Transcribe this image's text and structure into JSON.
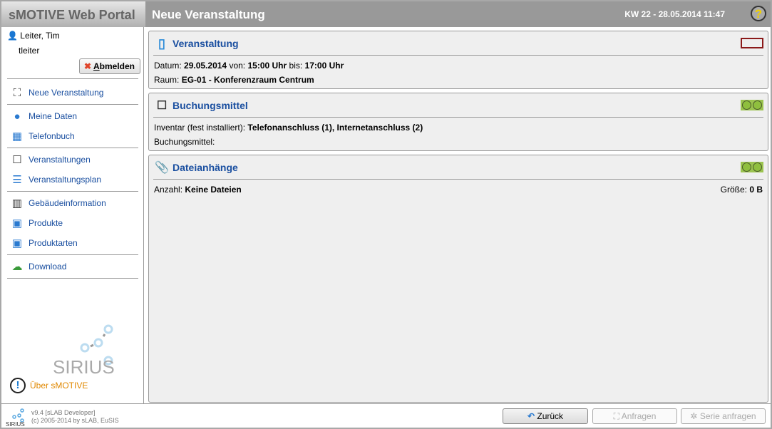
{
  "app_title": "sMOTIVE Web Portal",
  "header": {
    "title": "Neue Veranstaltung",
    "datetime": "KW 22 - 28.05.2014 11:47",
    "help_icon": "question-icon"
  },
  "user": {
    "name": "Leiter, Tim",
    "login": "tleiter",
    "logout_label": "Abmelden",
    "logout_accesskey": "A",
    "logout_rest": "bmelden"
  },
  "sidebar": {
    "items": [
      {
        "label": "Neue Veranstaltung",
        "icon": "new-event-icon"
      },
      {
        "label": "Meine Daten",
        "icon": "user-icon"
      },
      {
        "label": "Telefonbuch",
        "icon": "phonebook-icon"
      },
      {
        "label": "Veranstaltungen",
        "icon": "presentation-icon"
      },
      {
        "label": "Veranstaltungsplan",
        "icon": "schedule-icon"
      },
      {
        "label": "Gebäudeinformation",
        "icon": "building-icon"
      },
      {
        "label": "Produkte",
        "icon": "product-icon"
      },
      {
        "label": "Produktarten",
        "icon": "product-types-icon"
      },
      {
        "label": "Download",
        "icon": "download-cloud-icon"
      }
    ],
    "about_label": "Über sMOTIVE",
    "logo_text": "SIRIUS"
  },
  "panels": {
    "event": {
      "title": "Veranstaltung",
      "date_label": "Datum:",
      "date": "29.05.2014",
      "from_label": "von:",
      "from": "15:00 Uhr",
      "to_label": "bis:",
      "to": "17:00 Uhr",
      "room_label": "Raum:",
      "room": "EG-01 - Konferenzraum Centrum",
      "status": "red"
    },
    "resources": {
      "title": "Buchungsmittel",
      "inventory_label": "Inventar (fest installiert):",
      "inventory": "Telefonanschluss (1), Internetanschluss (2)",
      "resources_label": "Buchungsmittel:",
      "status": "green"
    },
    "attachments": {
      "title": "Dateianhänge",
      "count_label": "Anzahl:",
      "count": "Keine Dateien",
      "size_label": "Größe:",
      "size": "0 B",
      "status": "green"
    }
  },
  "footer": {
    "version": "v9.4 [sLAB Developer]",
    "copyright": "(c) 2005-2014 by sLAB, EuSIS",
    "back": "Zurück",
    "request": "Anfragen",
    "series_request": "Serie anfragen"
  },
  "colors": {
    "accent": "#1a4fa0",
    "header": "#999999",
    "status_green": "#9cc450",
    "status_red": "#8b1a1a",
    "about": "#e08800"
  }
}
